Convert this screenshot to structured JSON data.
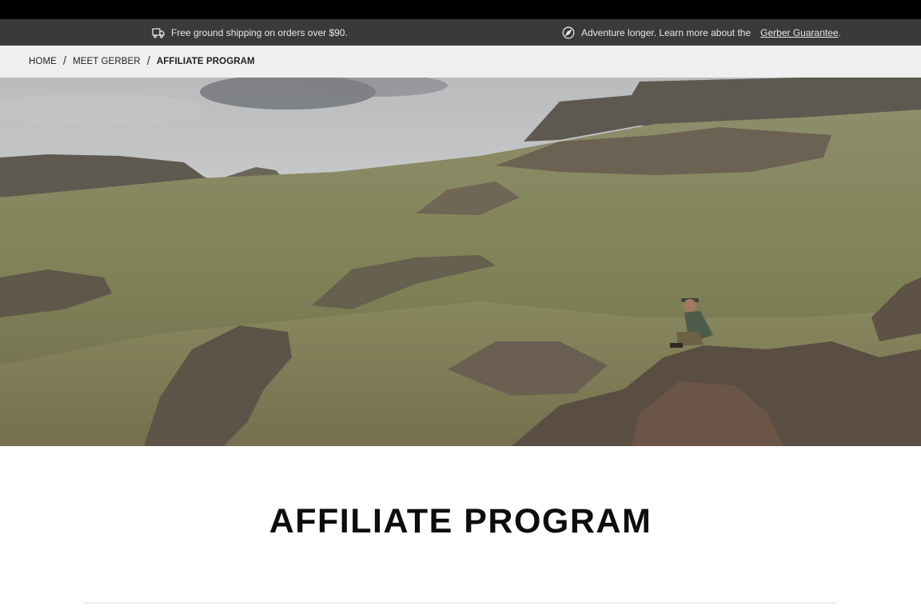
{
  "promo": {
    "shipping_text": "Free ground shipping on orders over $90.",
    "guarantee_text": "Adventure longer. Learn more about the",
    "guarantee_link": "Gerber Guarantee",
    "guarantee_suffix": "."
  },
  "breadcrumb": {
    "items": [
      {
        "label": "HOME"
      },
      {
        "label": "MEET GERBER"
      },
      {
        "label": "AFFILIATE PROGRAM"
      }
    ]
  },
  "hero": {
    "icon": "landscape-photo"
  },
  "page": {
    "title": "AFFILIATE PROGRAM"
  },
  "colors": {
    "promo_bg": "#3a3a3a",
    "breadcrumb_bg": "#efefef",
    "title": "#0d0d0d"
  }
}
